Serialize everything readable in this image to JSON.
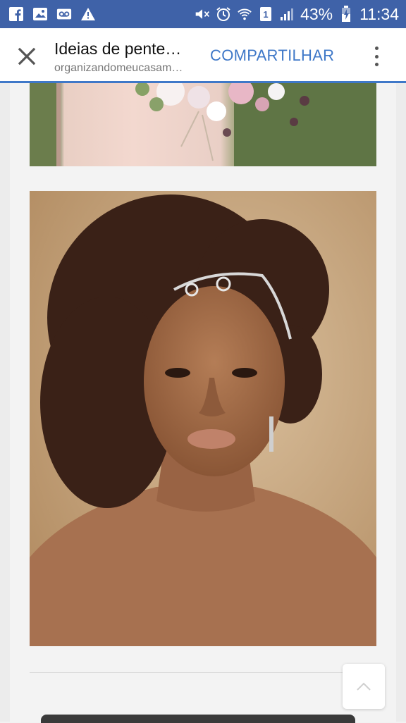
{
  "status_bar": {
    "battery": "43%",
    "time": "11:34",
    "sim": "1",
    "icons": [
      "facebook-icon",
      "gallery-icon",
      "voicemail-icon",
      "warning-icon",
      "mute-icon",
      "alarm-icon",
      "wifi-icon",
      "sim-icon",
      "signal-icon",
      "battery-icon"
    ]
  },
  "appbar": {
    "title": "Ideias de pente…",
    "url": "organizandomeucasam…",
    "share_label": "COMPARTILHAR",
    "close_icon": "close-icon",
    "more_icon": "more-vert-icon"
  },
  "colors": {
    "status_bar": "#3f62a8",
    "accent": "#3f78c8",
    "page_bg": "#f3f3f3"
  },
  "scroll_top_icon": "chevron-up-icon"
}
